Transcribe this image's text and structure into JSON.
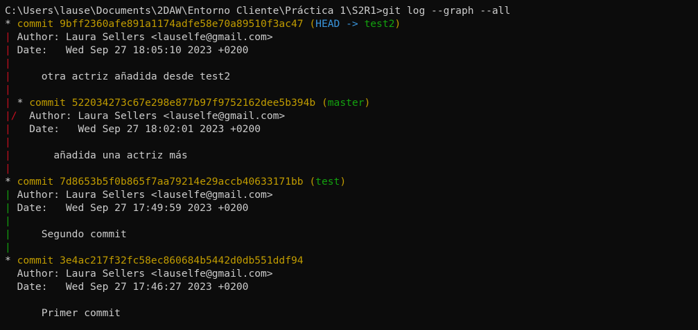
{
  "prompt": "C:\\Users\\lause\\Documents\\2DAW\\Entorno Cliente\\Práctica 1\\S2R1>",
  "command": "git log --graph --all",
  "graph": {
    "star": "*",
    "bar": "|",
    "slash": "/"
  },
  "commit_word": "commit",
  "commits": [
    {
      "hash": "9bff2360afe891a1174adfe58e70a89510f3ac47",
      "refs_open": "(",
      "head": "HEAD ->",
      "branch": "test2",
      "refs_close": ")",
      "author": "Author: Laura Sellers <lauselfe@gmail.com>",
      "date": "Date:   Wed Sep 27 18:05:10 2023 +0200",
      "message": "otra actriz añadida desde test2"
    },
    {
      "hash": "522034273c67e298e877b97f9752162dee5b394b",
      "refs_open": "(",
      "branch": "master",
      "refs_close": ")",
      "author": "Author: Laura Sellers <lauselfe@gmail.com>",
      "date": "Date:   Wed Sep 27 18:02:01 2023 +0200",
      "message": "añadida una actriz más"
    },
    {
      "hash": "7d8653b5f0b865f7aa79214e29accb40633171bb",
      "refs_open": "(",
      "branch": "test",
      "refs_close": ")",
      "author": "Author: Laura Sellers <lauselfe@gmail.com>",
      "date": "Date:   Wed Sep 27 17:49:59 2023 +0200",
      "message": "Segundo commit"
    },
    {
      "hash": "3e4ac217f32fc58ec860684b5442d0db551ddf94",
      "author": "Author: Laura Sellers <lauselfe@gmail.com>",
      "date": "Date:   Wed Sep 27 17:46:27 2023 +0200",
      "message": "Primer commit"
    }
  ],
  "colors": {
    "background": "#0c0c0c",
    "text": "#cccccc",
    "commit": "#c19c00",
    "head": "#3a96dd",
    "branch": "#13a10e",
    "graph_red": "#c50f1f",
    "graph_green": "#13a10e"
  }
}
